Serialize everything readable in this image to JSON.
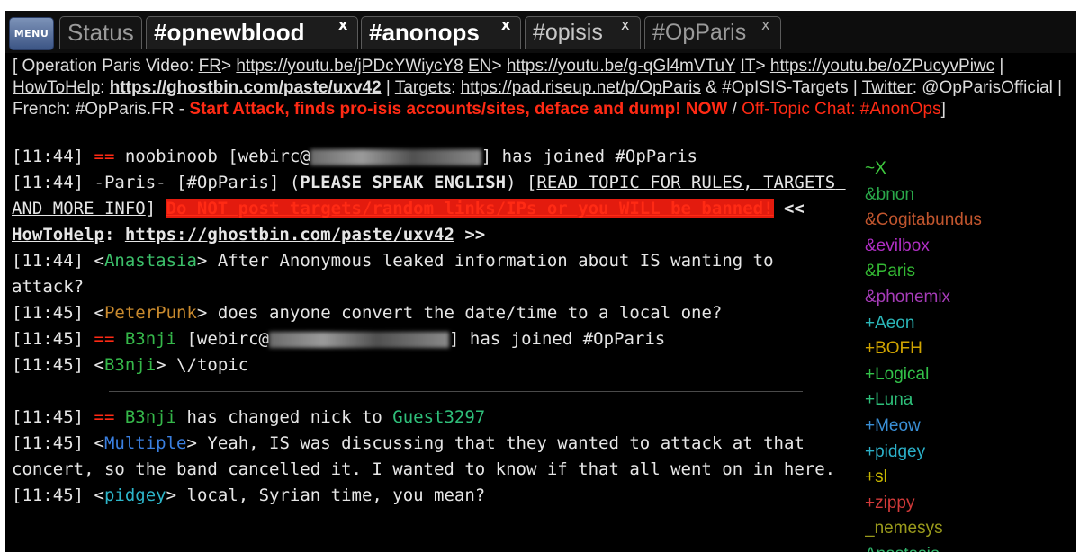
{
  "menu": {
    "label": "MENU"
  },
  "tabs": [
    {
      "label": "Status",
      "close": ""
    },
    {
      "label": "#opnewblood",
      "close": "x"
    },
    {
      "label": "#anonops",
      "close": "x"
    },
    {
      "label": "#opisis",
      "close": "x"
    },
    {
      "label": "#OpParis",
      "close": "x"
    }
  ],
  "topic": {
    "p1": "[ Operation Paris  Video: ",
    "fr": "FR",
    "p2": "> ",
    "url_fr": "https://youtu.be/jPDcYWiycY8",
    "p3": " ",
    "en": "EN",
    "p4": "> ",
    "url_en": "https://youtu.be/g-qGl4mVTuY",
    "p5": " ",
    "it": "IT",
    "p6": ">",
    "url_it": "https://youtu.be/oZPucyvPiwc",
    "p7": " | ",
    "howto": "HowToHelp",
    "p8": ": ",
    "url_ghost": "https://ghostbin.com/paste/uxv42",
    "p9": " | ",
    "targets": "Targets",
    "p10": ":",
    "url_pad": "https://pad.riseup.net/p/OpParis",
    "p11": " & #OpISIS-Targets | ",
    "twitter": "Twitter",
    "p12": ": @OpParisOfficial | French: #OpParis.FR - ",
    "attack": "Start Attack, finds pro-isis accounts/sites, deface and dump! NOW",
    "p13": " / ",
    "offtopic": "Off-Topic Chat: #AnonOps",
    "p14": "]"
  },
  "chat": {
    "l1": {
      "time": "[11:44] ",
      "arrow": "==",
      "t1": " noobinoob [webirc@",
      "t2": "] has joined #OpParis"
    },
    "l2": {
      "time": "[11:44] ",
      "t1": "-Paris- [#OpParis] (",
      "caps": "PLEASE SPEAK ENGLISH",
      "t2": ") [",
      "read": "READ TOPIC FOR RULES, TARGETS AND MORE INFO",
      "t3": "] ",
      "warn": "Do NOT post targets/random links/IPs or you WILL be banned!",
      "t4": " << ",
      "howto": "HowToHelp",
      "t5": ": ",
      "url": "https://ghostbin.com/paste/uxv42",
      "t6": " >>"
    },
    "l3": {
      "time": "[11:44] ",
      "lt": "<",
      "nick": "Anastasia",
      "gt": "> ",
      "msg": "After Anonymous leaked information about IS wanting to attack?"
    },
    "l4": {
      "time": "[11:45] ",
      "lt": "<",
      "nick": "PeterPunk",
      "gt": "> ",
      "msg": "does anyone convert the date/time to a local one?"
    },
    "l5": {
      "time": "[11:45] ",
      "arrow": "==",
      "nick": " B3nji",
      "t1": " [webirc@",
      "t2": "] has joined #OpParis"
    },
    "l6": {
      "time": "[11:45] ",
      "lt": "<",
      "nick": "B3nji",
      "gt": "> ",
      "msg": "\\/topic"
    },
    "l7": {
      "time": "[11:45] ",
      "arrow": "==",
      "nick": " B3nji",
      "t1": " has changed nick to ",
      "newnick": "Guest3297"
    },
    "l8": {
      "time": "[11:45] ",
      "lt": "<",
      "nick": "Multiple",
      "gt": "> ",
      "msg": "Yeah, IS was discussing that they wanted to attack at that concert, so the band cancelled it. I wanted to know if that all went on in here."
    },
    "l9": {
      "time": "[11:45] ",
      "lt": "<",
      "nick": "pidgey",
      "gt": "> ",
      "msg": "local, Syrian time, you mean?"
    }
  },
  "nicks": [
    {
      "name": "~X",
      "color": "#3ec93e"
    },
    {
      "name": "&bnon",
      "color": "#2aa84a"
    },
    {
      "name": "&Cogitabundus",
      "color": "#c2562e"
    },
    {
      "name": "&evilbox",
      "color": "#b02fc4"
    },
    {
      "name": "&Paris",
      "color": "#33b833"
    },
    {
      "name": "&phonemix",
      "color": "#a63cb8"
    },
    {
      "name": "+Aeon",
      "color": "#2bb6b8"
    },
    {
      "name": "+BOFH",
      "color": "#d0a400"
    },
    {
      "name": "+Logical",
      "color": "#33c24a"
    },
    {
      "name": "+Luna",
      "color": "#2ec07a"
    },
    {
      "name": "+Meow",
      "color": "#3a8fd6"
    },
    {
      "name": "+pidgey",
      "color": "#2bb0c8"
    },
    {
      "name": "+sl",
      "color": "#c9b800"
    },
    {
      "name": "+zippy",
      "color": "#d23a3a"
    },
    {
      "name": "_nemesys",
      "color": "#9a9a1c"
    },
    {
      "name": "Anastasia",
      "color": "#2fb36a"
    }
  ],
  "colors": {
    "anastasia": "#3cc06a",
    "peterpunk": "#c98a2e",
    "b3nji": "#35b84a",
    "guest": "#2fbf7a",
    "multiple": "#3a7fe0",
    "pidgey": "#2db5c9"
  }
}
